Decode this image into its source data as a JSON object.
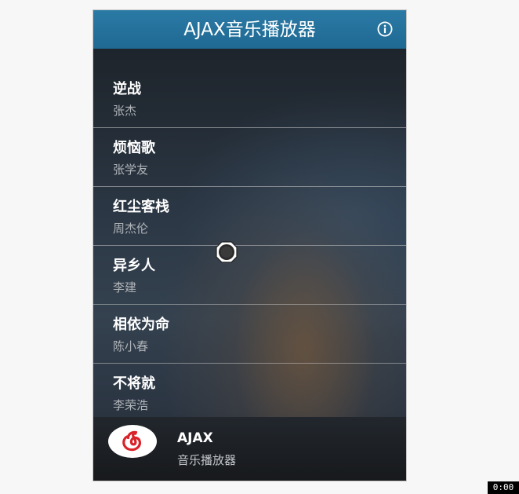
{
  "header": {
    "title": "AJAX音乐播放器",
    "info_icon": "info-circle-icon"
  },
  "songs": [
    {
      "title": "逆战",
      "artist": "张杰"
    },
    {
      "title": "烦恼歌",
      "artist": "张学友"
    },
    {
      "title": "红尘客栈",
      "artist": "周杰伦"
    },
    {
      "title": "异乡人",
      "artist": "李建"
    },
    {
      "title": "相依为命",
      "artist": "陈小春"
    },
    {
      "title": "不将就",
      "artist": "李荣浩"
    }
  ],
  "footer": {
    "logo_icon": "netease-music-logo-icon",
    "name": "AJAX",
    "subtitle": "音乐播放器"
  },
  "timer": "0:00",
  "colors": {
    "header_bg": "#2a7aa5",
    "logo_red": "#d9232a"
  }
}
